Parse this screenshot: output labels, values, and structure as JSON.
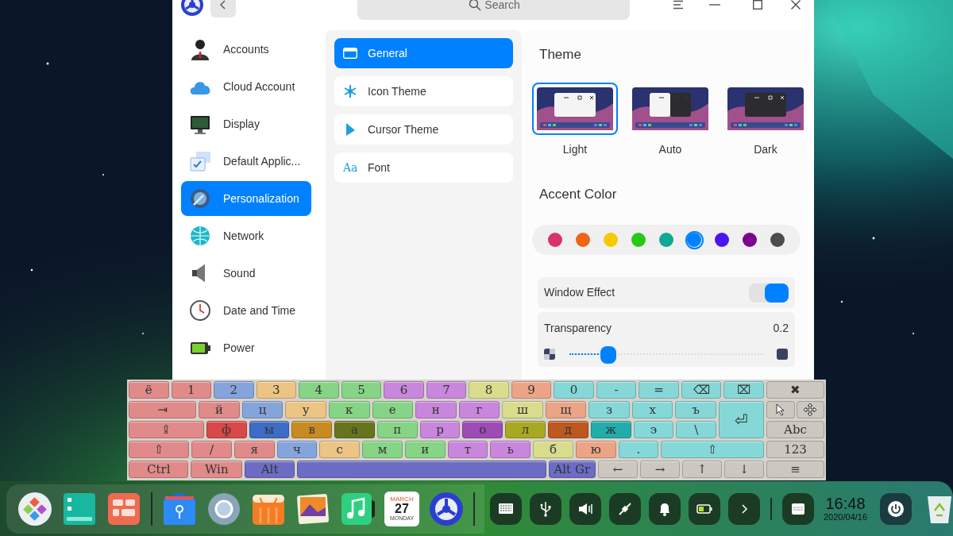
{
  "window": {
    "search": {
      "placeholder": "Search"
    }
  },
  "sidebar": {
    "items": [
      {
        "label": "Accounts",
        "kind": "user",
        "selected": false
      },
      {
        "label": "Cloud Account",
        "kind": "cloud",
        "selected": false
      },
      {
        "label": "Display",
        "kind": "display",
        "selected": false
      },
      {
        "label": "Default Applic...",
        "kind": "apps",
        "selected": false
      },
      {
        "label": "Personalization",
        "kind": "personalization",
        "selected": true
      },
      {
        "label": "Network",
        "kind": "network",
        "selected": false
      },
      {
        "label": "Sound",
        "kind": "sound",
        "selected": false
      },
      {
        "label": "Date and Time",
        "kind": "clock",
        "selected": false
      },
      {
        "label": "Power",
        "kind": "power",
        "selected": false
      }
    ]
  },
  "categories": {
    "items": [
      {
        "label": "General",
        "kind": "window",
        "selected": true
      },
      {
        "label": "Icon Theme",
        "kind": "snowflake",
        "selected": false
      },
      {
        "label": "Cursor Theme",
        "kind": "cursor",
        "selected": false
      },
      {
        "label": "Font",
        "kind": "glyph",
        "glyph": "Aa",
        "selected": false
      }
    ]
  },
  "theme": {
    "title": "Theme",
    "options": [
      {
        "label": "Light",
        "kind": "light",
        "selected": true
      },
      {
        "label": "Auto",
        "kind": "auto",
        "selected": false
      },
      {
        "label": "Dark",
        "kind": "dark",
        "selected": false
      }
    ]
  },
  "accent": {
    "title": "Accent Color",
    "colors": [
      {
        "color": "#d8336b",
        "selected": false
      },
      {
        "color": "#f06414",
        "selected": false
      },
      {
        "color": "#f8c800",
        "selected": false
      },
      {
        "color": "#28c814",
        "selected": false
      },
      {
        "color": "#10a890",
        "selected": false
      },
      {
        "color": "#0081ff",
        "selected": true
      },
      {
        "color": "#4c14f0",
        "selected": false
      },
      {
        "color": "#800090",
        "selected": false
      },
      {
        "color": "#4d4d4d",
        "selected": false
      }
    ]
  },
  "window_effect": {
    "label": "Window Effect",
    "on": true
  },
  "transparency": {
    "label": "Transparency",
    "reading": "0.2",
    "level": 0.2
  },
  "keyboard": {
    "rows": [
      {
        "keys": [
          {
            "label": "ё",
            "color": "#e08a8a"
          },
          {
            "label": "1",
            "color": "#e08a8a"
          },
          {
            "label": "2",
            "color": "#86a4dc"
          },
          {
            "label": "3",
            "color": "#ecc484"
          },
          {
            "label": "4",
            "color": "#86d486"
          },
          {
            "label": "5",
            "color": "#86d486"
          },
          {
            "label": "6",
            "color": "#c886dc"
          },
          {
            "label": "7",
            "color": "#c886dc"
          },
          {
            "label": "8",
            "color": "#d8dc8c"
          },
          {
            "label": "9",
            "color": "#eca486"
          },
          {
            "label": "0",
            "color": "#86d8d8"
          },
          {
            "label": "-",
            "color": "#86d8d8"
          },
          {
            "label": "=",
            "color": "#86d8d8"
          },
          {
            "label": "⌫",
            "color": "#86d8d8"
          },
          {
            "label": "⌧",
            "color": "#86d8d8"
          }
        ]
      },
      {
        "keys": [
          {
            "label": "⇥",
            "color": "#e08a8a"
          },
          {
            "label": "й",
            "color": "#e08a8a"
          },
          {
            "label": "ц",
            "color": "#86a4dc"
          },
          {
            "label": "у",
            "color": "#ecc484"
          },
          {
            "label": "к",
            "color": "#86d486"
          },
          {
            "label": "е",
            "color": "#86d486"
          },
          {
            "label": "н",
            "color": "#c886dc"
          },
          {
            "label": "г",
            "color": "#c886dc"
          },
          {
            "label": "ш",
            "color": "#d8dc8c"
          },
          {
            "label": "щ",
            "color": "#eca486"
          },
          {
            "label": "з",
            "color": "#86d8d8"
          },
          {
            "label": "х",
            "color": "#86d8d8"
          },
          {
            "label": "ъ",
            "color": "#86d8d8"
          }
        ]
      },
      {
        "keys": [
          {
            "label": "⇪",
            "color": "#e08a8a"
          },
          {
            "label": "ф",
            "color": "#d84848"
          },
          {
            "label": "ы",
            "color": "#3c6cc4"
          },
          {
            "label": "в",
            "color": "#c88a22"
          },
          {
            "label": "а",
            "color": "#66741e"
          },
          {
            "label": "п",
            "color": "#86d486"
          },
          {
            "label": "р",
            "color": "#c886dc"
          },
          {
            "label": "о",
            "color": "#9c4cb4"
          },
          {
            "label": "л",
            "color": "#a8a822"
          },
          {
            "label": "д",
            "color": "#bc5820"
          },
          {
            "label": "ж",
            "color": "#22acac"
          },
          {
            "label": "э",
            "color": "#86d8d8"
          },
          {
            "label": "\\",
            "color": "#86d8d8"
          }
        ]
      },
      {
        "keys": [
          {
            "label": "⇧",
            "color": "#e08a8a"
          },
          {
            "label": "/",
            "color": "#e08a8a"
          },
          {
            "label": "я",
            "color": "#e08a8a"
          },
          {
            "label": "ч",
            "color": "#86a4dc"
          },
          {
            "label": "с",
            "color": "#ecc484"
          },
          {
            "label": "м",
            "color": "#86d486"
          },
          {
            "label": "и",
            "color": "#86d486"
          },
          {
            "label": "т",
            "color": "#c886dc"
          },
          {
            "label": "ь",
            "color": "#c886dc"
          },
          {
            "label": "б",
            "color": "#d8dc8c"
          },
          {
            "label": "ю",
            "color": "#eca486"
          },
          {
            "label": ".",
            "color": "#86d8d8"
          },
          {
            "label": "⇧",
            "color": "#86d8d8"
          }
        ]
      }
    ],
    "enter": {
      "label": "⏎",
      "color": "#86d8d8"
    },
    "bottom_left": [
      {
        "label": "Ctrl",
        "color": "#e08a8a"
      },
      {
        "label": "Win",
        "color": "#e08a8a"
      },
      {
        "label": "Alt",
        "color": "#6c6cc4"
      }
    ],
    "space": {
      "color": "#6c6cc4"
    },
    "bottom_right": [
      {
        "label": "Alt Gr",
        "color": "#6c6cc4"
      },
      {
        "label": "←",
        "color": "#ccc8c0"
      },
      {
        "label": "→",
        "color": "#ccc8c0"
      },
      {
        "label": "↑",
        "color": "#ccc8c0"
      },
      {
        "label": "↓",
        "color": "#ccc8c0"
      }
    ],
    "side": [
      {
        "keys": [
          {
            "kind": "text",
            "label": "✖"
          }
        ]
      },
      {
        "keys": [
          {
            "kind": "pointer"
          },
          {
            "kind": "move"
          }
        ]
      },
      {
        "keys": [
          {
            "kind": "text",
            "label": "Abc"
          }
        ]
      },
      {
        "keys": [
          {
            "kind": "text",
            "label": "123"
          }
        ]
      },
      {
        "keys": [
          {
            "kind": "text",
            "label": "≡"
          }
        ]
      }
    ]
  },
  "dock": {
    "apps": [
      {
        "kind": "launcher"
      },
      {
        "kind": "files"
      },
      {
        "kind": "tiles"
      },
      {
        "kind": "separator"
      },
      {
        "kind": "folder"
      },
      {
        "kind": "browser"
      },
      {
        "kind": "store"
      },
      {
        "kind": "photos"
      },
      {
        "kind": "music"
      },
      {
        "kind": "calendar",
        "month": "MARCH",
        "day": "27",
        "weekday": "MONDAY"
      },
      {
        "kind": "settings"
      },
      {
        "kind": "separator"
      }
    ],
    "tray": [
      {
        "kind": "keyboard"
      },
      {
        "kind": "usb"
      },
      {
        "kind": "volume"
      },
      {
        "kind": "plug"
      },
      {
        "kind": "bell"
      },
      {
        "kind": "battery"
      },
      {
        "kind": "more"
      }
    ],
    "layout_button": {
      "kind": "keyboard-layout"
    },
    "clock": {
      "time": "16:48",
      "date": "2020/04/16"
    }
  }
}
